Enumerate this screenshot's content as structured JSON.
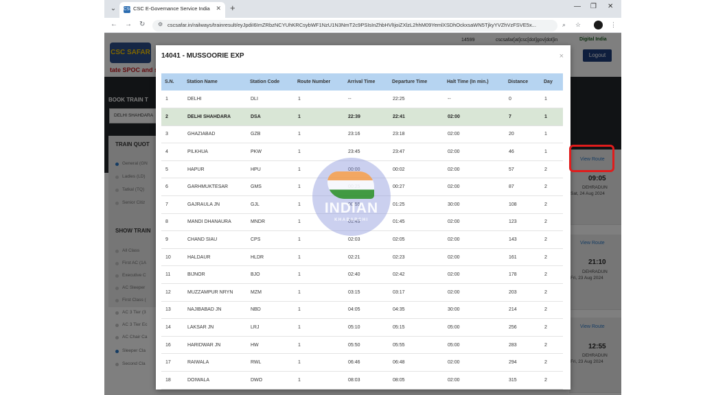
{
  "browser": {
    "tab_title": "CSC E-Governance Service India",
    "tab_favicon": "CSC",
    "address_url": "cscsafar.in/railways/trainresult/eyJpdiI6ImZRbzNCYUhKRCsybWF1NzU1N3NmT2c9PSIsInZhbHVlIjoiZXlzL2hhM09YemlXSDhOckxsaWN5TjkyYVZhVzFSVE5x..."
  },
  "site": {
    "logo_text": "CSC SAFAR",
    "spoc_text": "tate SPOC and s",
    "helpline": "14599",
    "email": "cscsafar[at]csc[dot]gov[dot]in",
    "digital_india": "Digital India",
    "logout_label": "Logout",
    "book_label": "BOOK TRAIN T",
    "from_value": "DELHI SHAHDARA",
    "quota_heading": "TRAIN QUOT",
    "quota_options": [
      "General (GN",
      "Ladies (LD)",
      "Tatkal (TQ)",
      "Senior Citiz"
    ],
    "show_heading": "SHOW TRAIN",
    "class_options": [
      "All Class",
      "First AC (1A",
      "Executive C",
      "AC Sleeper",
      "First Class (",
      "AC 3 Tier (3",
      "AC 3 Tier Ec",
      "AC Chair Ca",
      "Sleeper Cla",
      "Second Cla"
    ],
    "cards": [
      {
        "view_route": "View Route",
        "time": "09:05",
        "dest": "DEHRADUN",
        "date": "Sat, 24 Aug 2024"
      },
      {
        "view_route": "View Route",
        "time": "21:10",
        "dest": "DEHRADUN",
        "date": "Fri, 23 Aug 2024"
      },
      {
        "view_route": "View Route",
        "time": "12:55",
        "dest": "DEHRADUN",
        "date": "Fri, 23 Aug 2024"
      }
    ]
  },
  "modal": {
    "title": "14041 - MUSSOORIE EXP",
    "close_label": "×",
    "headers": [
      "S.N.",
      "Station Name",
      "Station Code",
      "Route Number",
      "Arrival Time",
      "Departure Time",
      "Halt Time (In min.)",
      "Distance",
      "Day"
    ],
    "rows": [
      [
        "1",
        "DELHI",
        "DLI",
        "1",
        "--",
        "22:25",
        "--",
        "0",
        "1"
      ],
      [
        "2",
        "DELHI SHAHDARA",
        "DSA",
        "1",
        "22:39",
        "22:41",
        "02:00",
        "7",
        "1"
      ],
      [
        "3",
        "GHAZIABAD",
        "GZB",
        "1",
        "23:16",
        "23:18",
        "02:00",
        "20",
        "1"
      ],
      [
        "4",
        "PILKHUA",
        "PKW",
        "1",
        "23:45",
        "23:47",
        "02:00",
        "46",
        "1"
      ],
      [
        "5",
        "HAPUR",
        "HPU",
        "1",
        "00:00",
        "00:02",
        "02:00",
        "57",
        "2"
      ],
      [
        "6",
        "GARHMUKTESAR",
        "GMS",
        "1",
        "00:25",
        "00:27",
        "02:00",
        "87",
        "2"
      ],
      [
        "7",
        "GAJRAULA JN",
        "GJL",
        "1",
        "00:55",
        "01:25",
        "30:00",
        "108",
        "2"
      ],
      [
        "8",
        "MANDI DHANAURA",
        "MNDR",
        "1",
        "01:43",
        "01:45",
        "02:00",
        "123",
        "2"
      ],
      [
        "9",
        "CHAND SIAU",
        "CPS",
        "1",
        "02:03",
        "02:05",
        "02:00",
        "143",
        "2"
      ],
      [
        "10",
        "HALDAUR",
        "HLDR",
        "1",
        "02:21",
        "02:23",
        "02:00",
        "161",
        "2"
      ],
      [
        "11",
        "BIJNOR",
        "BJO",
        "1",
        "02:40",
        "02:42",
        "02:00",
        "178",
        "2"
      ],
      [
        "12",
        "MUZZAMPUR NRYN",
        "MZM",
        "1",
        "03:15",
        "03:17",
        "02:00",
        "203",
        "2"
      ],
      [
        "13",
        "NAJIBABAD JN",
        "NBD",
        "1",
        "04:05",
        "04:35",
        "30:00",
        "214",
        "2"
      ],
      [
        "14",
        "LAKSAR JN",
        "LRJ",
        "1",
        "05:10",
        "05:15",
        "05:00",
        "256",
        "2"
      ],
      [
        "16",
        "HARIDWAR JN",
        "HW",
        "1",
        "05:50",
        "05:55",
        "05:00",
        "283",
        "2"
      ],
      [
        "17",
        "RAIWALA",
        "RWL",
        "1",
        "06:46",
        "06:48",
        "02:00",
        "294",
        "2"
      ],
      [
        "18",
        "DOIWALA",
        "DWO",
        "1",
        "08:03",
        "08:05",
        "02:00",
        "315",
        "2"
      ]
    ],
    "highlight_row": 1
  },
  "watermark": {
    "title": "INDIAN",
    "subtitle": "KHABARCHI"
  }
}
